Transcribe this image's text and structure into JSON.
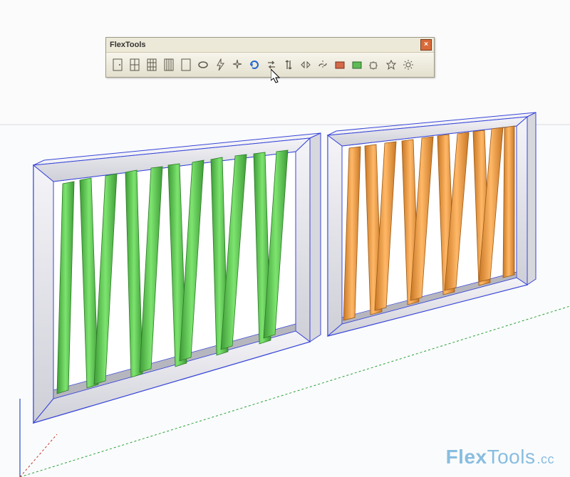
{
  "toolbar": {
    "title": "FlexTools",
    "close_label": "×",
    "buttons": [
      {
        "name": "flex-door",
        "tip": "FlexDoor"
      },
      {
        "name": "flex-window",
        "tip": "FlexWindow"
      },
      {
        "name": "flex-window-grid",
        "tip": "FlexWindow Grid"
      },
      {
        "name": "flex-slats",
        "tip": "FlexSlats"
      },
      {
        "name": "flex-frame",
        "tip": "FlexFrame"
      },
      {
        "name": "flex-ellipse",
        "tip": "FlexEllipse"
      },
      {
        "name": "flex-bolt",
        "tip": "Zap"
      },
      {
        "name": "flex-sparkle",
        "tip": "Sparkle"
      },
      {
        "name": "refresh",
        "tip": "Refresh"
      },
      {
        "name": "flip",
        "tip": "Flip"
      },
      {
        "name": "arrows-vert",
        "tip": "Vertical Arrows"
      },
      {
        "name": "mirror-horiz",
        "tip": "Mirror"
      },
      {
        "name": "link-break",
        "tip": "Break Link"
      },
      {
        "name": "component-red",
        "tip": "Component A"
      },
      {
        "name": "component-green",
        "tip": "Component B"
      },
      {
        "name": "puzzle",
        "tip": "Extensions"
      },
      {
        "name": "favorite",
        "tip": "Favorite"
      },
      {
        "name": "settings",
        "tip": "Settings"
      }
    ]
  },
  "watermark": {
    "brand_bold": "Flex",
    "brand_light": "Tools",
    "suffix": ".cc"
  },
  "scene": {
    "panel_green": {
      "slat_color": "#66d35b",
      "frame_color": "#e3e3ea"
    },
    "panel_orange": {
      "slat_color": "#f2a147",
      "frame_color": "#e3e3ea"
    }
  }
}
